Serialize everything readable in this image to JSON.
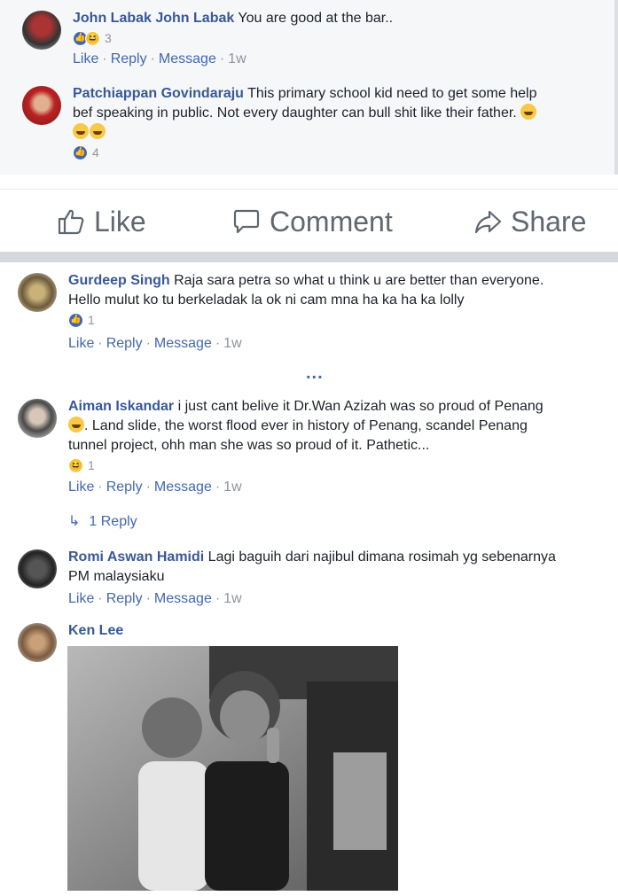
{
  "top_comments": [
    {
      "author": "John Labak John Labak",
      "text": "You are good at the bar..",
      "reaction_count": "3",
      "actions": {
        "like": "Like",
        "reply": "Reply",
        "message": "Message",
        "time": "1w"
      }
    },
    {
      "author": "Patchiappan Govindaraju",
      "text_line1": "This primary school kid need to get some help",
      "text_line2": "bef speaking in public. Not every daughter can bull shit like their father.",
      "reaction_count": "4"
    }
  ],
  "action_bar": {
    "like": "Like",
    "comment": "Comment",
    "share": "Share"
  },
  "comments": [
    {
      "author": "Gurdeep Singh",
      "text_line1": "Raja sara petra so what u think u are better than everyone.",
      "text_line2": "Hello mulut ko tu berkeladak la ok ni cam mna ha ka ha ka lolly",
      "reaction_count": "1",
      "actions": {
        "like": "Like",
        "reply": "Reply",
        "message": "Message",
        "time": "1w"
      }
    },
    {
      "author": "Aiman Iskandar",
      "text_line1": "i just cant belive it Dr.Wan Azizah was so proud of Penang",
      "text_line2": ". Land slide, the worst flood ever in history of Penang, scandel Penang",
      "text_line3": "tunnel project, ohh man she was so proud of it. Pathetic...",
      "reaction_count": "1",
      "actions": {
        "like": "Like",
        "reply": "Reply",
        "message": "Message",
        "time": "1w"
      },
      "replies_label": "1 Reply"
    },
    {
      "author": "Romi Aswan Hamidi",
      "text_line1": "Lagi baguih dari najibul dimana rosimah yg sebenarnya",
      "text_line2": "PM malaysiaku",
      "actions": {
        "like": "Like",
        "reply": "Reply",
        "message": "Message",
        "time": "1w"
      }
    },
    {
      "author": "Ken Lee"
    }
  ],
  "more_label": "...",
  "colors": {
    "link": "#385898",
    "meta": "#90949c",
    "like_blue": "#4267b2"
  }
}
